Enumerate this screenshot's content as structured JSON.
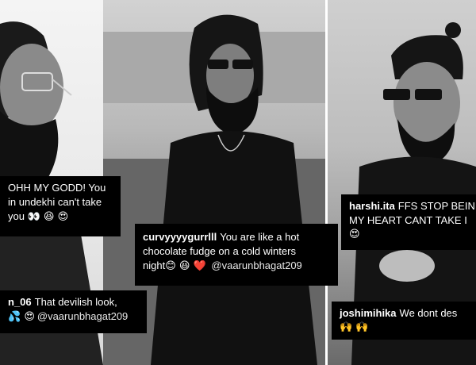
{
  "comments": [
    {
      "user": "",
      "lines": [
        "OHH MY GODD! You",
        "in undekhi can't take",
        "you"
      ],
      "emojis": "👀 😆 😍"
    },
    {
      "user": "n_06",
      "lines": [
        "That devilish look,"
      ],
      "emojis": "💦 😍",
      "mention": "@vaarunbhagat209"
    },
    {
      "user": "curvyyyygurrlll",
      "lines": [
        "You are like a hot",
        "chocolate fudge on a cold winters",
        "night"
      ],
      "emojis": "😊 😆 ❤️",
      "mention": "@vaarunbhagat209"
    },
    {
      "user": "harshi.ita",
      "lines": [
        "FFS STOP BEIN",
        "MY HEART CANT TAKE I"
      ],
      "emojis": "😍"
    },
    {
      "user": "joshimihika",
      "lines": [
        "We dont des"
      ],
      "emojis": "🙌 🙌"
    }
  ]
}
